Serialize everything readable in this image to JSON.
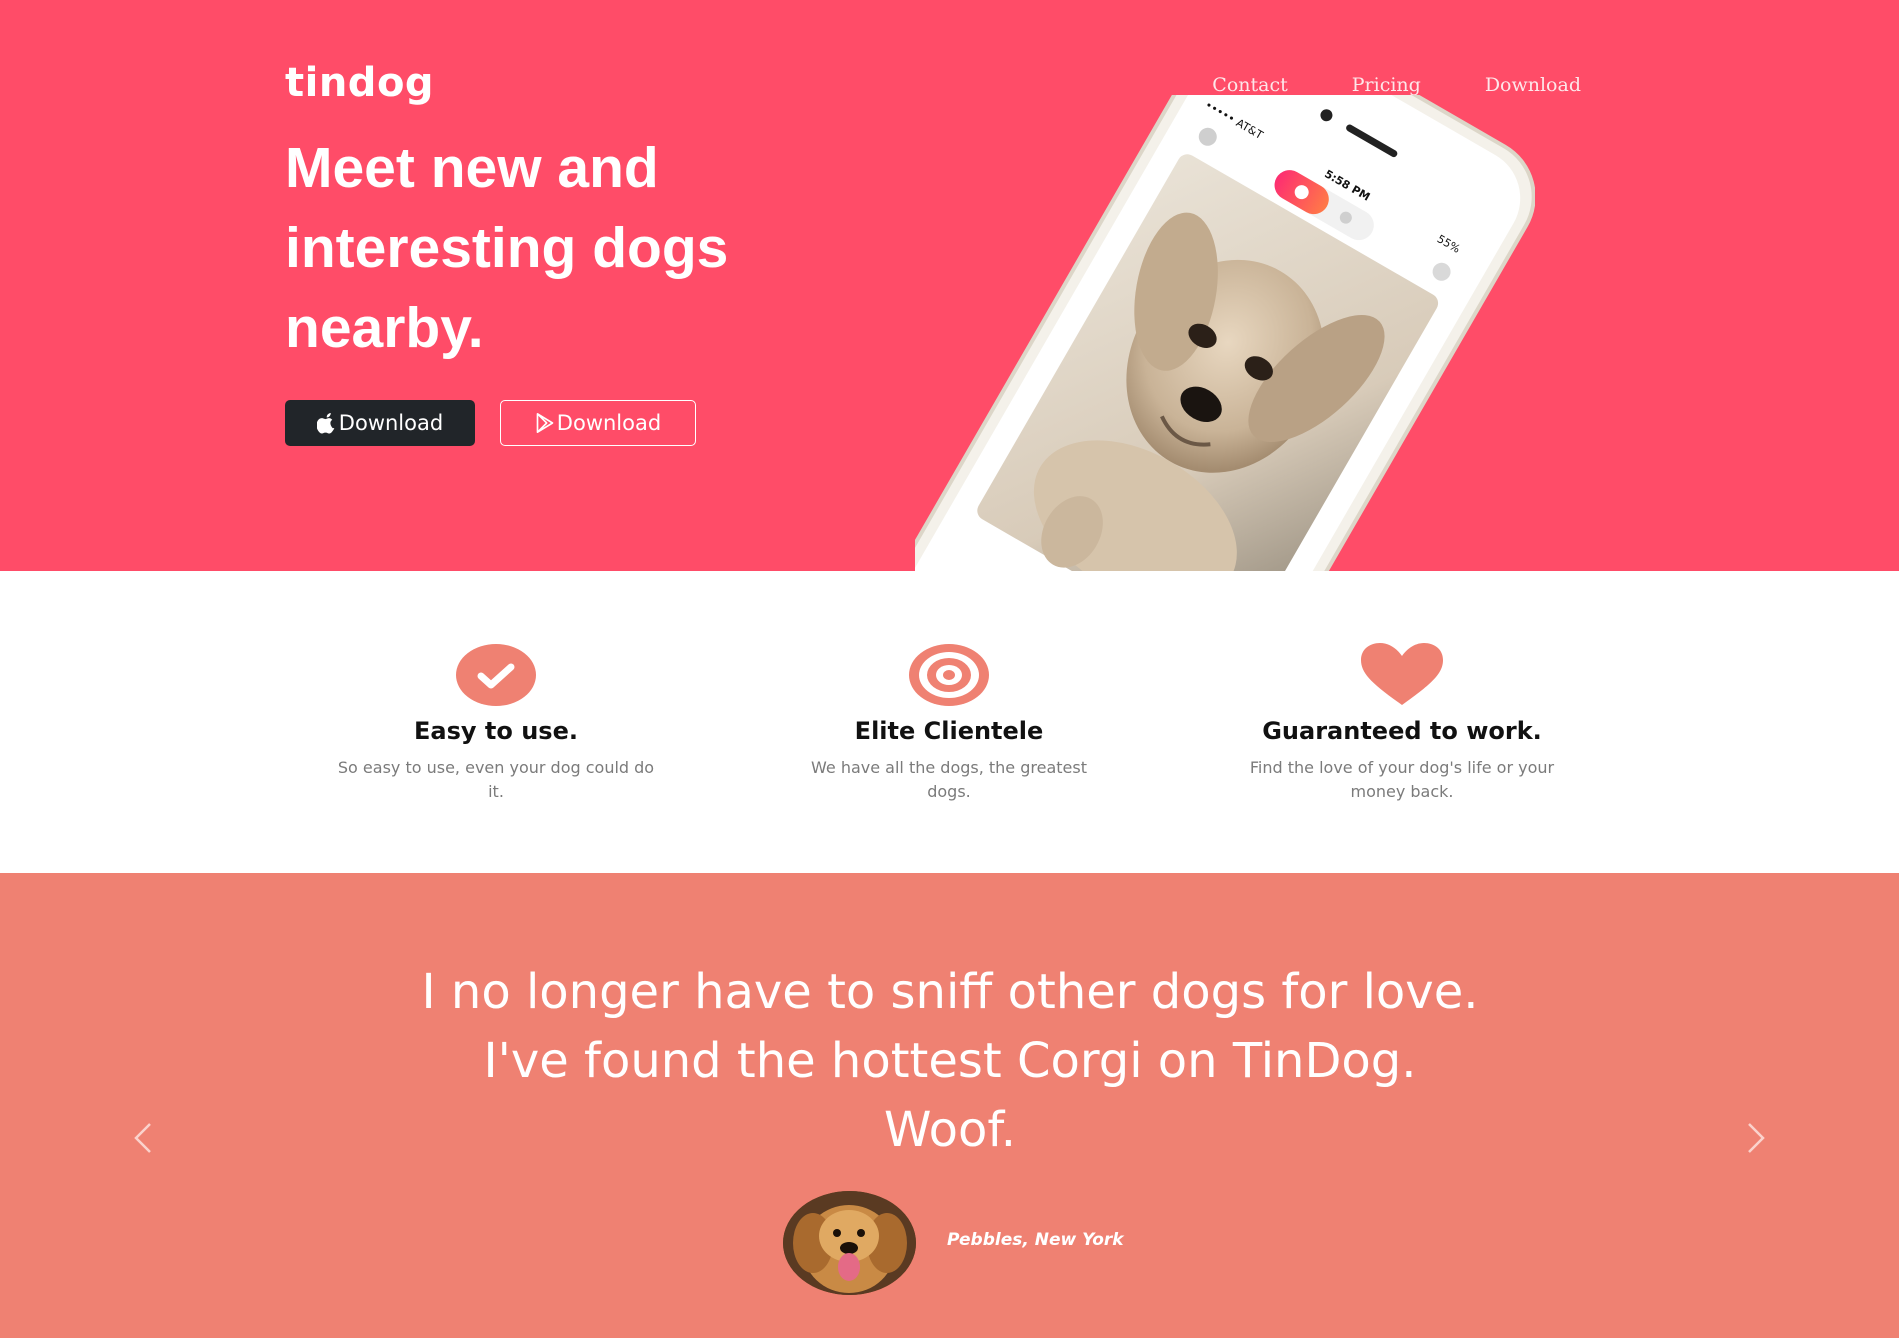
{
  "brand": {
    "name": "tindog"
  },
  "nav": {
    "items": [
      "Contact",
      "Pricing",
      "Download"
    ]
  },
  "hero": {
    "headline_lines": [
      "Meet new and",
      "interesting dogs",
      "nearby."
    ],
    "buttons": {
      "apple_label": "Download",
      "google_label": "Download",
      "apple_icon": "apple-icon",
      "google_icon": "google-play-icon"
    },
    "phone_status": {
      "carrier": "AT&T",
      "time": "5:58 PM",
      "battery": "55%"
    }
  },
  "features": [
    {
      "icon": "check-circle-icon",
      "title": "Easy to use.",
      "description": "So easy to use, even your dog could do it."
    },
    {
      "icon": "bullseye-icon",
      "title": "Elite Clientele",
      "description": "We have all the dogs, the greatest dogs."
    },
    {
      "icon": "heart-icon",
      "title": "Guaranteed to work.",
      "description": "Find the love of your dog's life or your money back."
    }
  ],
  "testimonial": {
    "quote_lines": [
      "I no longer have to sniff other dogs for love.",
      "I've found the hottest Corgi on TinDog.",
      "Woof."
    ],
    "author": "Pebbles, New York"
  },
  "colors": {
    "hero_bg": "#ff4c68",
    "accent": "#ef8172",
    "dark_button": "#212529",
    "text_dark": "#111111",
    "text_muted": "#7b7b7b"
  }
}
